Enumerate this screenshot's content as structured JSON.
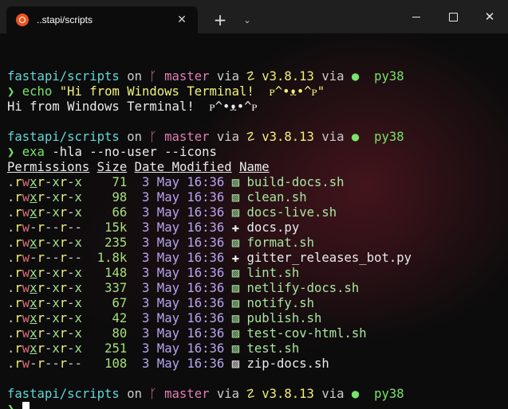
{
  "window": {
    "tab_title": "..stapi/scripts",
    "tab_close_glyph": "✕",
    "new_tab_glyph": "+",
    "dropdown_glyph": "⌄",
    "close_glyph": "✕"
  },
  "colors": {
    "background": "#0c0c0c",
    "titlebar": "#1f1f1f",
    "cyan": "#61d6d6",
    "pink": "#e27eb3",
    "yellow": "#f2f27a",
    "green": "#79e36a",
    "date": "#b7a6f2"
  },
  "prompt": {
    "path": "fastapi/scripts",
    "on": "on",
    "branch_icon": "ᚴ",
    "branch": "master",
    "via1": "via",
    "python_icon": "🐍",
    "python_version": "v3.8.13",
    "via2": "via",
    "env_icon": "●",
    "env": "py38",
    "arrow": "❯"
  },
  "cmd1": {
    "command": "echo",
    "argument": "\"Hi from Windows Terminal!  ᴩ^•ᴥ•^ᴩ\"",
    "output": "Hi from Windows Terminal!  ᴩ^•ᴥ•^ᴩ"
  },
  "cmd2": {
    "command": "exa",
    "arguments": "-hla --no-user --icons"
  },
  "listing": {
    "headers": {
      "permissions": "Permissions",
      "size": "Size",
      "date": "Date Modified",
      "name": "Name"
    },
    "rows": [
      {
        "perm": [
          ".",
          "r",
          "w",
          "x",
          "r",
          "-",
          "x",
          "r",
          "-",
          "x"
        ],
        "size": "71",
        "date": "3 May 16:36",
        "icon": "▨",
        "name": "build-docs.sh",
        "type": "sh"
      },
      {
        "perm": [
          ".",
          "r",
          "w",
          "x",
          "r",
          "-",
          "x",
          "r",
          "-",
          "x"
        ],
        "size": "98",
        "date": "3 May 16:36",
        "icon": "▨",
        "name": "clean.sh",
        "type": "sh"
      },
      {
        "perm": [
          ".",
          "r",
          "w",
          "x",
          "r",
          "-",
          "x",
          "r",
          "-",
          "x"
        ],
        "size": "66",
        "date": "3 May 16:36",
        "icon": "▨",
        "name": "docs-live.sh",
        "type": "sh"
      },
      {
        "perm": [
          ".",
          "r",
          "w",
          "-",
          "r",
          "-",
          "-",
          "r",
          "-",
          "-"
        ],
        "size": "15k",
        "date": "3 May 16:36",
        "icon": "✚",
        "name": "docs.py",
        "type": "py"
      },
      {
        "perm": [
          ".",
          "r",
          "w",
          "x",
          "r",
          "-",
          "x",
          "r",
          "-",
          "x"
        ],
        "size": "235",
        "date": "3 May 16:36",
        "icon": "▨",
        "name": "format.sh",
        "type": "sh"
      },
      {
        "perm": [
          ".",
          "r",
          "w",
          "-",
          "r",
          "-",
          "-",
          "r",
          "-",
          "-"
        ],
        "size": "1.8k",
        "date": "3 May 16:36",
        "icon": "✚",
        "name": "gitter_releases_bot.py",
        "type": "py"
      },
      {
        "perm": [
          ".",
          "r",
          "w",
          "x",
          "r",
          "-",
          "x",
          "r",
          "-",
          "x"
        ],
        "size": "148",
        "date": "3 May 16:36",
        "icon": "▨",
        "name": "lint.sh",
        "type": "sh"
      },
      {
        "perm": [
          ".",
          "r",
          "w",
          "x",
          "r",
          "-",
          "x",
          "r",
          "-",
          "x"
        ],
        "size": "337",
        "date": "3 May 16:36",
        "icon": "▨",
        "name": "netlify-docs.sh",
        "type": "sh"
      },
      {
        "perm": [
          ".",
          "r",
          "w",
          "x",
          "r",
          "-",
          "x",
          "r",
          "-",
          "x"
        ],
        "size": "67",
        "date": "3 May 16:36",
        "icon": "▨",
        "name": "notify.sh",
        "type": "sh"
      },
      {
        "perm": [
          ".",
          "r",
          "w",
          "x",
          "r",
          "-",
          "x",
          "r",
          "-",
          "x"
        ],
        "size": "42",
        "date": "3 May 16:36",
        "icon": "▨",
        "name": "publish.sh",
        "type": "sh"
      },
      {
        "perm": [
          ".",
          "r",
          "w",
          "x",
          "r",
          "-",
          "x",
          "r",
          "-",
          "x"
        ],
        "size": "80",
        "date": "3 May 16:36",
        "icon": "▨",
        "name": "test-cov-html.sh",
        "type": "sh"
      },
      {
        "perm": [
          ".",
          "r",
          "w",
          "x",
          "r",
          "-",
          "x",
          "r",
          "-",
          "x"
        ],
        "size": "251",
        "date": "3 May 16:36",
        "icon": "▨",
        "name": "test.sh",
        "type": "sh"
      },
      {
        "perm": [
          ".",
          "r",
          "w",
          "-",
          "r",
          "-",
          "-",
          "r",
          "-",
          "-"
        ],
        "size": "108",
        "date": "3 May 16:36",
        "icon": "▨",
        "name": "zip-docs.sh",
        "type": "plain"
      }
    ]
  }
}
